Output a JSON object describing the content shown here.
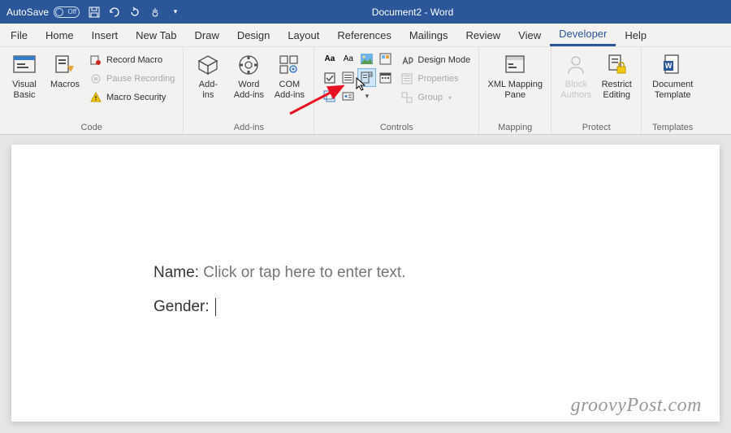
{
  "titlebar": {
    "autosave_label": "AutoSave",
    "autosave_state": "Off",
    "document_title": "Document2 - Word"
  },
  "menu": {
    "tabs": [
      "File",
      "Home",
      "Insert",
      "New Tab",
      "Draw",
      "Design",
      "Layout",
      "References",
      "Mailings",
      "Review",
      "View",
      "Developer",
      "Help"
    ],
    "active": "Developer"
  },
  "ribbon": {
    "code": {
      "label": "Code",
      "visual_basic": "Visual\nBasic",
      "macros": "Macros",
      "record_macro": "Record Macro",
      "pause_recording": "Pause Recording",
      "macro_security": "Macro Security"
    },
    "addins": {
      "label": "Add-ins",
      "addins_btn": "Add-\nins",
      "word_addins": "Word\nAdd-ins",
      "com_addins": "COM\nAdd-ins"
    },
    "controls": {
      "label": "Controls",
      "design_mode": "Design Mode",
      "properties": "Properties",
      "group": "Group"
    },
    "mapping": {
      "label": "Mapping",
      "xml_pane": "XML Mapping\nPane"
    },
    "protect": {
      "label": "Protect",
      "block_authors": "Block\nAuthors",
      "restrict": "Restrict\nEditing"
    },
    "templates": {
      "label": "Templates",
      "doc_template": "Document\nTemplate"
    }
  },
  "document": {
    "name_label": "Name: ",
    "name_placeholder": "Click or tap here to enter text.",
    "gender_label": "Gender: "
  },
  "watermark": "groovyPost.com"
}
